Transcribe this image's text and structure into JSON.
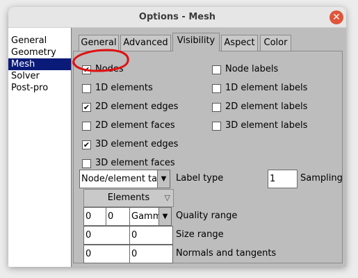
{
  "window": {
    "title": "Options - Mesh"
  },
  "categories": [
    {
      "label": "General"
    },
    {
      "label": "Geometry"
    },
    {
      "label": "Mesh"
    },
    {
      "label": "Solver"
    },
    {
      "label": "Post-pro"
    }
  ],
  "tabs": [
    {
      "label": "General"
    },
    {
      "label": "Advanced"
    },
    {
      "label": "Visibility"
    },
    {
      "label": "Aspect"
    },
    {
      "label": "Color"
    }
  ],
  "active_tab": "Visibility",
  "checkboxes": {
    "nodes": {
      "label": "Nodes",
      "checked": true
    },
    "node_labels": {
      "label": "Node labels",
      "checked": false
    },
    "elements_1d": {
      "label": "1D elements",
      "checked": false
    },
    "element_labels_1d": {
      "label": "1D element labels",
      "checked": false
    },
    "element_edges_2d": {
      "label": "2D element edges",
      "checked": true
    },
    "element_labels_2d": {
      "label": "2D element labels",
      "checked": false
    },
    "element_faces_2d": {
      "label": "2D element faces",
      "checked": false
    },
    "element_labels_3d": {
      "label": "3D element labels",
      "checked": false
    },
    "element_edges_3d": {
      "label": "3D element edges",
      "checked": true
    },
    "element_faces_3d": {
      "label": "3D element faces",
      "checked": false
    }
  },
  "label_type": {
    "value": "Node/element ta",
    "label": "Label type"
  },
  "sampling": {
    "value": "1",
    "label": "Sampling"
  },
  "elements_menu": {
    "label": "Elements"
  },
  "quality_range": {
    "min": "0",
    "max": "0",
    "measure": "Gamm",
    "label": "Quality range"
  },
  "size_range": {
    "min": "0",
    "max": "0",
    "label": "Size range"
  },
  "normals": {
    "min": "0",
    "max": "0",
    "label": "Normals and tangents"
  },
  "colors": {
    "selection": "#0a1a78",
    "close_button": "#e0553a",
    "annotation": "#e01010"
  }
}
